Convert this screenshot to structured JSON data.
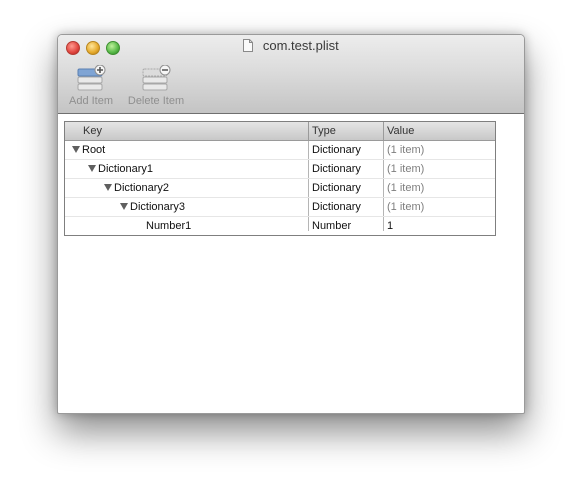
{
  "window": {
    "title": "com.test.plist"
  },
  "toolbar": {
    "add_label": "Add Item",
    "delete_label": "Delete Item"
  },
  "table": {
    "headers": {
      "key": "Key",
      "type": "Type",
      "value": "Value"
    },
    "rows": [
      {
        "key": "Root",
        "type": "Dictionary",
        "value": "(1 item)",
        "expanded": true
      },
      {
        "key": "Dictionary1",
        "type": "Dictionary",
        "value": "(1 item)",
        "expanded": true
      },
      {
        "key": "Dictionary2",
        "type": "Dictionary",
        "value": "(1 item)",
        "expanded": true
      },
      {
        "key": "Dictionary3",
        "type": "Dictionary",
        "value": "(1 item)",
        "expanded": true
      },
      {
        "key": "Number1",
        "type": "Number",
        "value": "1"
      }
    ]
  },
  "icons": {
    "close": "close-button-icon",
    "minimize": "minimize-button-icon",
    "zoom": "zoom-button-icon",
    "document": "document-icon",
    "add": "add-item-icon",
    "delete": "delete-item-icon",
    "disclosure": "disclosure-triangle-icon"
  }
}
